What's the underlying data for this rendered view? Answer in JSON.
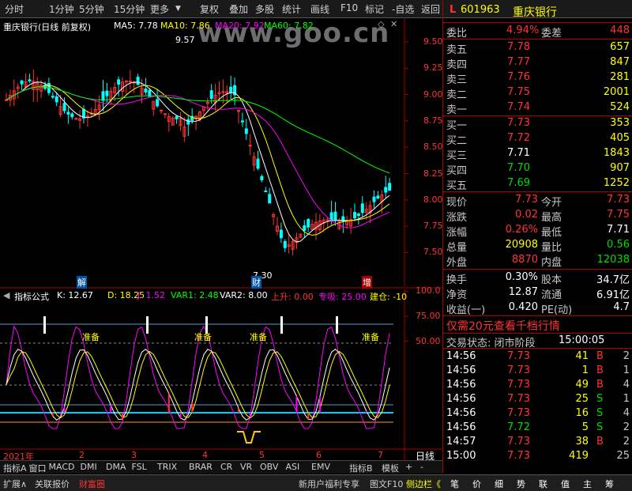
{
  "toolbar": {
    "left": [
      "分时",
      "1分钟",
      "5分钟",
      "15分钟",
      "更多"
    ],
    "right": [
      "复权",
      "叠加",
      "多股",
      "统计",
      "画线",
      "F10",
      "标记",
      "-自选",
      "返回"
    ]
  },
  "watermark": "www.goo.cn",
  "main_legend": {
    "title": "重庆银行(日线 前复权)",
    "ma5": "MA5: 7.78",
    "ma10": "MA10: 7.86",
    "ma20": "MA20: 7.92",
    "ma60": "MA60: 7.82"
  },
  "price_axis": [
    "9.50",
    "9.25",
    "9.00",
    "8.75",
    "8.50",
    "8.25",
    "8.00",
    "7.75",
    "7.50"
  ],
  "annot": {
    "high": "9.57",
    "low": "7.30",
    "m1": "解",
    "m2": "财",
    "m3": "增"
  },
  "sub_legend": {
    "name": "指标公式",
    "k": "K: 12.67",
    "d": "D: 18.25",
    "j": "J: 1.52",
    "var1": "VAR1: 2.48",
    "var2": "VAR2: 8.00",
    "up": "上升: 0.00",
    "absorb": "专吸: 25.00",
    "build": "建仓: -10"
  },
  "sub_axis": [
    "100.0",
    "75.00",
    "50.00"
  ],
  "prep_label": "准备",
  "time_axis": [
    "2021年",
    "2",
    "3",
    "4",
    "5",
    "6",
    "7"
  ],
  "day_line": "日线",
  "tabs": [
    "指标A",
    "窗口",
    "MACD",
    "DMI",
    "DMA",
    "FSL",
    "TRIX",
    "BRAR",
    "CR",
    "VR",
    "OBV",
    "ASI",
    "EMV"
  ],
  "tabs_right": [
    "指标B",
    "模板",
    "+",
    "-"
  ],
  "bottom_left": [
    "扩展∧",
    "关联报价",
    "财富圈"
  ],
  "bottom_mid": [
    "新用户福利专享",
    "图文F10",
    "侧边栏《"
  ],
  "bottom_right": [
    "笔",
    "价",
    "细",
    "势",
    "联",
    "值",
    "主",
    "筹"
  ],
  "stock": {
    "mark": "L",
    "code": "601963",
    "name": "重庆银行"
  },
  "weibi": {
    "l1": "委比",
    "v1": "4.94%",
    "l2": "委差",
    "v2": "448"
  },
  "asks": [
    {
      "label": "卖五",
      "price": "7.78",
      "vol": "657"
    },
    {
      "label": "卖四",
      "price": "7.77",
      "vol": "847"
    },
    {
      "label": "卖三",
      "price": "7.76",
      "vol": "281"
    },
    {
      "label": "卖二",
      "price": "7.75",
      "vol": "2001"
    },
    {
      "label": "卖一",
      "price": "7.74",
      "vol": "524"
    }
  ],
  "bids": [
    {
      "label": "买一",
      "price": "7.73",
      "vol": "353"
    },
    {
      "label": "买二",
      "price": "7.72",
      "vol": "405"
    },
    {
      "label": "买三",
      "price": "7.71",
      "vol": "1843"
    },
    {
      "label": "买四",
      "price": "7.70",
      "vol": "907"
    },
    {
      "label": "买五",
      "price": "7.69",
      "vol": "1252"
    }
  ],
  "quote": [
    {
      "l1": "现价",
      "v1": "7.73",
      "l2": "今开",
      "v2": "7.73"
    },
    {
      "l1": "涨跌",
      "v1": "0.02",
      "l2": "最高",
      "v2": "7.75"
    },
    {
      "l1": "涨幅",
      "v1": "0.26%",
      "l2": "最低",
      "v2": "7.71"
    },
    {
      "l1": "总量",
      "v1": "20908",
      "l2": "量比",
      "v2": "0.56"
    },
    {
      "l1": "外盘",
      "v1": "8870",
      "l2": "内盘",
      "v2": "12038"
    }
  ],
  "fin": [
    {
      "l1": "换手",
      "v1": "0.30%",
      "l2": "股本",
      "v2": "34.7亿"
    },
    {
      "l1": "净资",
      "v1": "12.87",
      "l2": "流通",
      "v2": "6.91亿"
    },
    {
      "l1": "收益(一)",
      "v1": "0.420",
      "l2": "PE(动)",
      "v2": "4.7"
    }
  ],
  "promo": "仅需20元查看千档行情",
  "status": {
    "label": "交易状态: 闭市阶段",
    "time": "15:00:05"
  },
  "ticks": [
    {
      "t": "14:56",
      "p": "7.73",
      "v": "41",
      "s": "B",
      "n": "2"
    },
    {
      "t": "14:56",
      "p": "7.73",
      "v": "1",
      "s": "B",
      "n": "1"
    },
    {
      "t": "14:56",
      "p": "7.73",
      "v": "49",
      "s": "B",
      "n": "4"
    },
    {
      "t": "14:56",
      "p": "7.73",
      "v": "25",
      "s": "S",
      "n": "1"
    },
    {
      "t": "14:56",
      "p": "7.73",
      "v": "16",
      "s": "S",
      "n": "4"
    },
    {
      "t": "14:56",
      "p": "7.72",
      "v": "5",
      "s": "S",
      "n": "2"
    },
    {
      "t": "14:57",
      "p": "7.73",
      "v": "38",
      "s": "B",
      "n": "2"
    },
    {
      "t": "15:00",
      "p": "7.73",
      "v": "419",
      "s": "",
      "n": "25"
    }
  ]
}
